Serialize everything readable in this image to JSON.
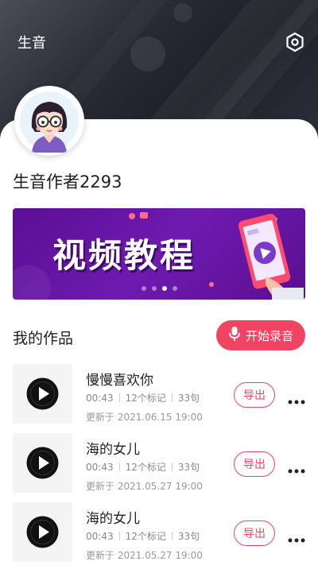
{
  "header": {
    "title": "生音"
  },
  "profile": {
    "username": "生音作者2293"
  },
  "banner": {
    "text": "视频教程"
  },
  "section": {
    "title": "我的作品",
    "record_label": "开始录音"
  },
  "colors": {
    "accent": "#f04462",
    "banner_bg": "#5a0f93",
    "header_bg": "#2a2c35"
  },
  "works": [
    {
      "title": "慢慢喜欢你",
      "duration": "00:43",
      "marks": "12个标记",
      "sentences": "33句",
      "updated": "更新于 2021.06.15 19:00",
      "export_label": "导出"
    },
    {
      "title": "海的女儿",
      "duration": "00:43",
      "marks": "12个标记",
      "sentences": "33句",
      "updated": "更新于 2021.05.27 19:00",
      "export_label": "导出"
    },
    {
      "title": "海的女儿",
      "duration": "00:43",
      "marks": "12个标记",
      "sentences": "33句",
      "updated": "更新于 2021.05.27 19:00",
      "export_label": "导出"
    }
  ],
  "icons": [
    "settings-icon",
    "microphone-icon",
    "vinyl-play-icon",
    "more-dots-icon"
  ]
}
